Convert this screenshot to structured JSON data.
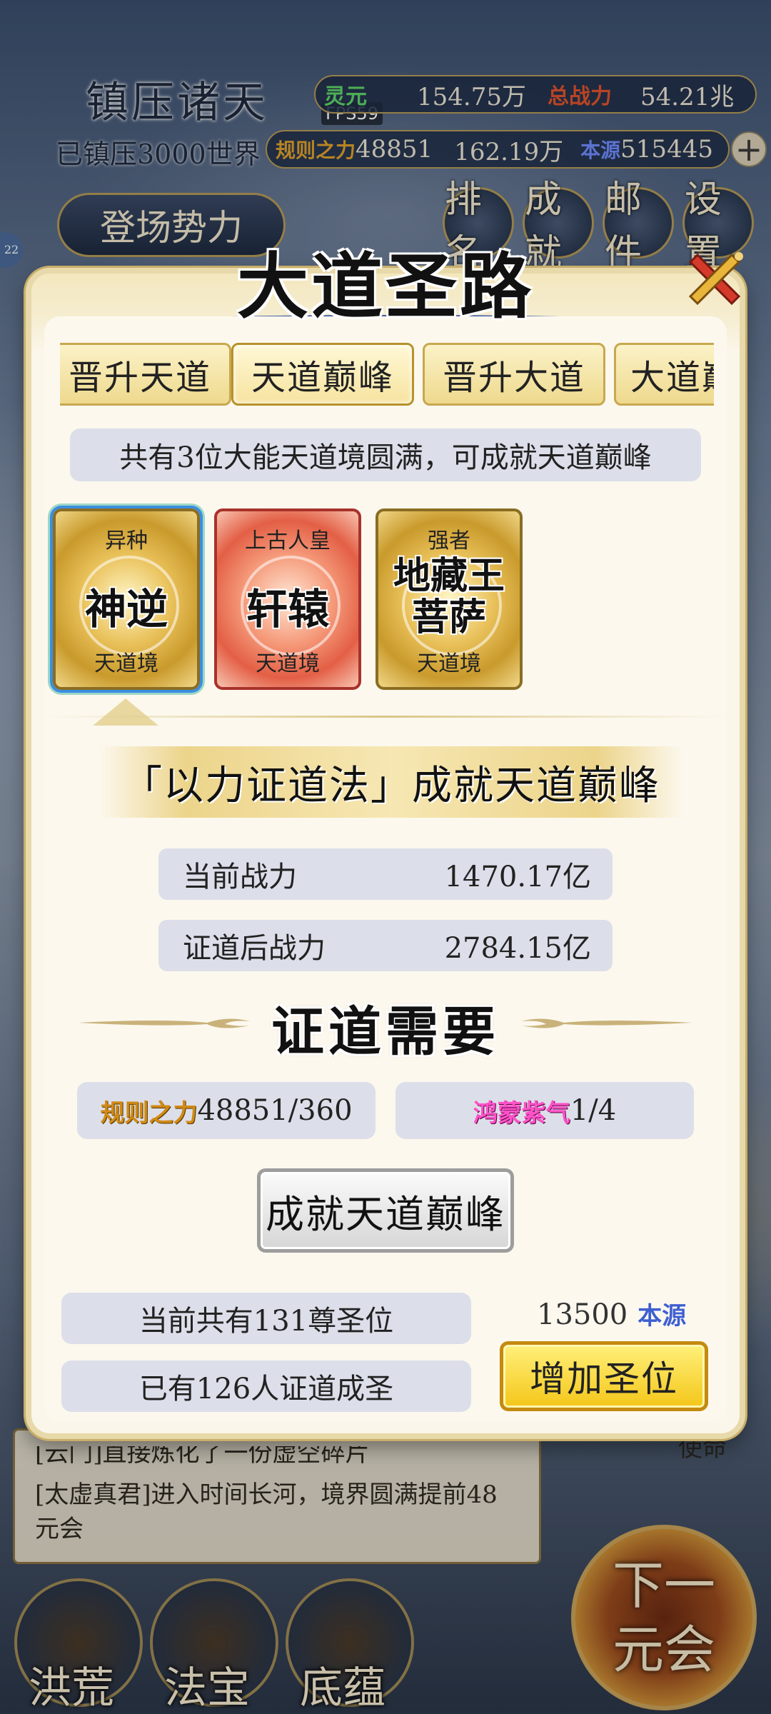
{
  "hud": {
    "title": "镇压诸天",
    "suppressed": "已镇压3000世界",
    "fps": "FPS59",
    "lingyuan_label": "灵元",
    "lingyuan_value": "154.75万",
    "total_power_label": "总战力",
    "total_power_value": "54.21兆",
    "rule_power_label": "规则之力",
    "rule_power_value": "48851",
    "stat_mid_value": "162.19万",
    "benyuan_label": "本源",
    "benyuan_value": "515445",
    "enter_factions": "登场势力",
    "rank": "排名",
    "achievement": "成就",
    "mail": "邮件",
    "settings": "设置"
  },
  "modal": {
    "title": "大道圣路",
    "tabs": [
      "晋升天道",
      "天道巅峰",
      "晋升大道",
      "大道巅"
    ],
    "active_tab": 1,
    "notice": "共有3位大能天道境圆满，可成就天道巅峰",
    "cards": [
      {
        "tag": "异种",
        "name": "神逆",
        "realm": "天道境",
        "style": "gold",
        "selected": true
      },
      {
        "tag": "上古人皇",
        "name": "轩辕",
        "realm": "天道境",
        "style": "red",
        "selected": false
      },
      {
        "tag": "强者",
        "name": "地藏王菩萨",
        "realm": "天道境",
        "style": "gold",
        "selected": false
      }
    ],
    "banner": "「以力证道法」成就天道巅峰",
    "current_power_label": "当前战力",
    "current_power_value": "1470.17亿",
    "after_power_label": "证道后战力",
    "after_power_value": "2784.15亿",
    "requirements_title": "证道需要",
    "req1_label": "规则之力",
    "req1_value": "48851/360",
    "req2_label": "鸿蒙紫气",
    "req2_value": "1/4",
    "achieve_button": "成就天道巅峰",
    "seats_info": "当前共有131尊圣位",
    "saints_info": "已有126人证道成圣",
    "cost_value": "13500",
    "cost_unit": "本源",
    "add_seat_button": "增加圣位"
  },
  "background": {
    "log_line1": "[云门]直接炼化了一份虚空碎片",
    "log_line2": "[太虚真君]进入时间长河，境界圆满提前48元会",
    "mission": "使命",
    "next_era": "下一元会",
    "nav": [
      "洪荒",
      "法宝",
      "底蕴"
    ]
  },
  "colors": {
    "accent_gold": "#e7d9aa",
    "panel_bg": "#fcf8ee",
    "info_bg": "#dcdfe9",
    "add_button": "#f4c619",
    "close_red": "#d43a2a"
  }
}
